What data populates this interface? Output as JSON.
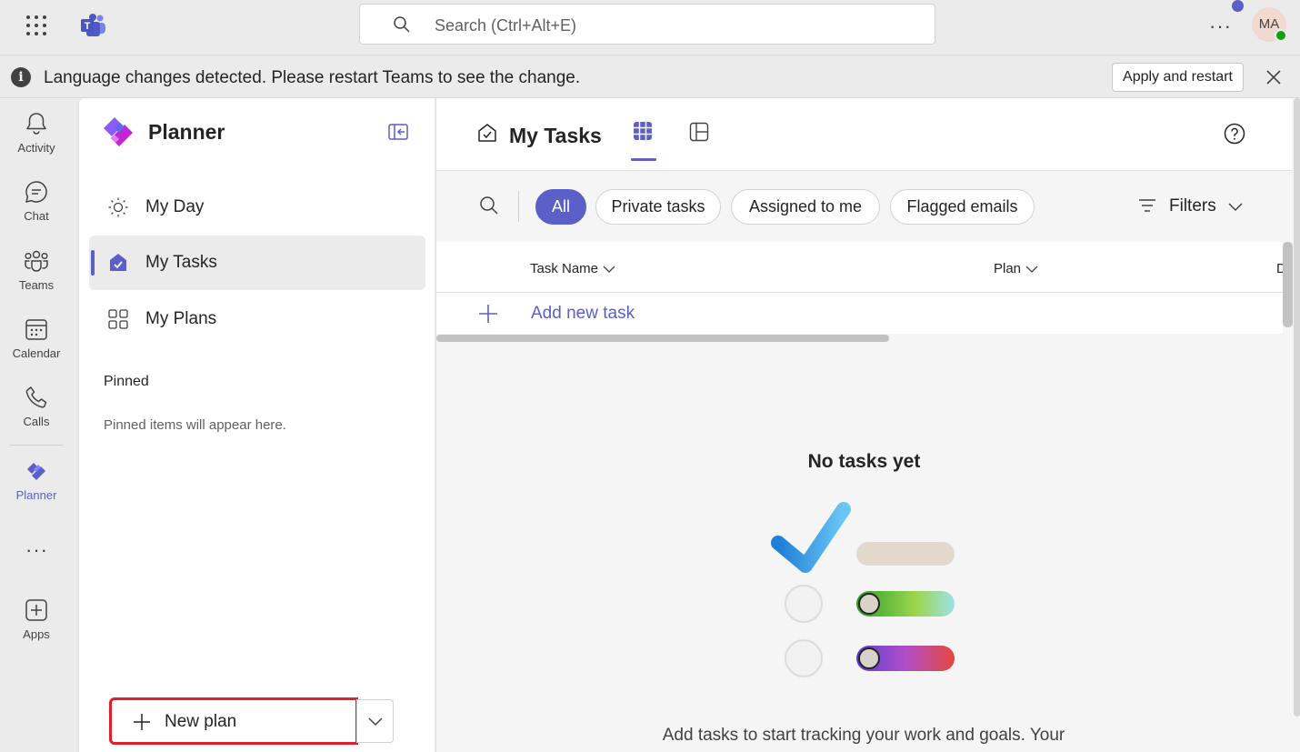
{
  "topbar": {
    "search_placeholder": "Search (Ctrl+Alt+E)",
    "more_label": "···",
    "avatar_initials": "MA"
  },
  "banner": {
    "message": "Language changes detected. Please restart Teams to see the change.",
    "apply_label": "Apply and restart"
  },
  "rail": {
    "items": [
      {
        "label": "Activity",
        "icon": "bell-icon"
      },
      {
        "label": "Chat",
        "icon": "chat-icon"
      },
      {
        "label": "Teams",
        "icon": "teams-icon"
      },
      {
        "label": "Calendar",
        "icon": "calendar-icon"
      },
      {
        "label": "Calls",
        "icon": "phone-icon"
      },
      {
        "label": "Planner",
        "icon": "planner-icon"
      },
      {
        "label": "Apps",
        "icon": "add-square-icon"
      }
    ],
    "more_label": "···"
  },
  "sidebar": {
    "title": "Planner",
    "nav": [
      {
        "label": "My Day",
        "icon": "sun-icon"
      },
      {
        "label": "My Tasks",
        "icon": "task-check-icon",
        "active": true
      },
      {
        "label": "My Plans",
        "icon": "grid-icon"
      }
    ],
    "pinned_title": "Pinned",
    "pinned_empty": "Pinned items will appear here.",
    "new_plan_label": "New plan"
  },
  "main": {
    "title": "My Tasks",
    "chips": [
      {
        "label": "All",
        "active": true
      },
      {
        "label": "Private tasks",
        "active": false
      },
      {
        "label": "Assigned to me",
        "active": false
      },
      {
        "label": "Flagged emails",
        "active": false
      }
    ],
    "filters_label": "Filters",
    "columns": [
      "Task Name",
      "Plan",
      "D"
    ],
    "add_task_label": "Add new task",
    "empty_title": "No tasks yet",
    "empty_desc": "Add tasks to start tracking your work and goals. Your"
  },
  "colors": {
    "accent": "#5b5fc7",
    "highlight_border": "#e0202a",
    "status_online": "#13a10e"
  }
}
